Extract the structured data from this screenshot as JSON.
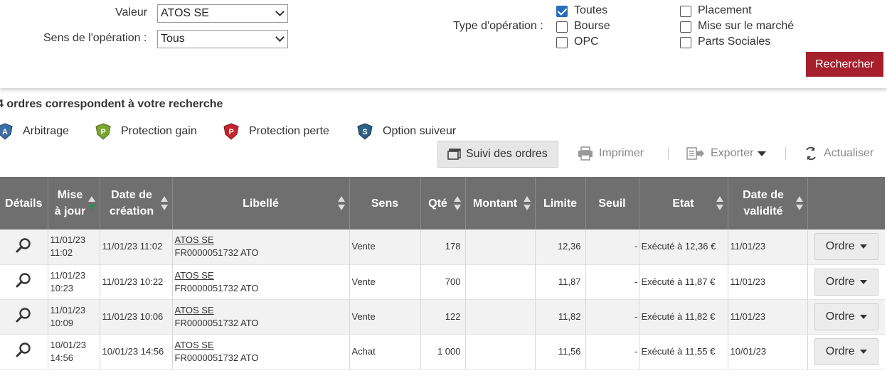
{
  "filters": {
    "valeur_label": "Valeur",
    "valeur_value": "ATOS SE",
    "sens_label": "Sens de l'opération :",
    "sens_value": "Tous",
    "type_label": "Type d'opération :",
    "types": [
      {
        "label": "Toutes",
        "checked": true
      },
      {
        "label": "Bourse",
        "checked": false
      },
      {
        "label": "OPC",
        "checked": false
      },
      {
        "label": "Placement",
        "checked": false
      },
      {
        "label": "Mise sur le marché",
        "checked": false
      },
      {
        "label": "Parts Sociales",
        "checked": false
      }
    ],
    "search_button": "Rechercher"
  },
  "results": {
    "count_text": "4 ordres correspondent à votre recherche",
    "legend": [
      {
        "letter": "A",
        "label": "Arbitrage",
        "color": "#3a6ea5"
      },
      {
        "letter": "P",
        "label": "Protection gain",
        "color": "#7aa531"
      },
      {
        "letter": "P",
        "label": "Protection perte",
        "color": "#c8242e"
      },
      {
        "letter": "S",
        "label": "Option suiveur",
        "color": "#2f5f83"
      }
    ],
    "toolbar": {
      "suivi": "Suivi des ordres",
      "imprimer": "Imprimer",
      "exporter": "Exporter",
      "actualiser": "Actualiser"
    }
  },
  "table": {
    "headers": [
      "Détails",
      "Mise à jour",
      "Date de création",
      "Libellé",
      "Sens",
      "Qté",
      "Montant",
      "Limite",
      "Seuil",
      "Etat",
      "Date de validité",
      ""
    ],
    "rows": [
      {
        "maj_date": "11/01/23",
        "maj_time": "11:02",
        "creation": "11/01/23 11:02",
        "lib_name": "ATOS SE",
        "lib_code": "FR0000051732 ATO",
        "sens": "Vente",
        "qte": "178",
        "montant": "",
        "limite": "12,36",
        "seuil": "-",
        "etat": "Exécuté à 12,36 €",
        "validite": "11/01/23",
        "action": "Ordre"
      },
      {
        "maj_date": "11/01/23",
        "maj_time": "10:23",
        "creation": "11/01/23 10:22",
        "lib_name": "ATOS SE",
        "lib_code": "FR0000051732 ATO",
        "sens": "Vente",
        "qte": "700",
        "montant": "",
        "limite": "11,87",
        "seuil": "-",
        "etat": "Exécuté à 11,87 €",
        "validite": "11/01/23",
        "action": "Ordre"
      },
      {
        "maj_date": "11/01/23",
        "maj_time": "10:09",
        "creation": "11/01/23 10:06",
        "lib_name": "ATOS SE",
        "lib_code": "FR0000051732 ATO",
        "sens": "Vente",
        "qte": "122",
        "montant": "",
        "limite": "11,82",
        "seuil": "-",
        "etat": "Exécuté à 11,82 €",
        "validite": "11/01/23",
        "action": "Ordre"
      },
      {
        "maj_date": "10/01/23",
        "maj_time": "14:56",
        "creation": "10/01/23 14:56",
        "lib_name": "ATOS SE",
        "lib_code": "FR0000051732 ATO",
        "sens": "Achat",
        "qte": "1 000",
        "montant": "",
        "limite": "11,56",
        "seuil": "-",
        "etat": "Exécuté à 11,55 €",
        "validite": "10/01/23",
        "action": "Ordre"
      }
    ]
  },
  "icons": {
    "details": "magnifier-icon",
    "print": "printer-icon",
    "export": "export-icon",
    "refresh": "refresh-icon",
    "suivi": "window-icon"
  },
  "colors": {
    "accent": "#a51f2d",
    "header_bg": "#6f6f6f",
    "checkbox": "#2a6ebb"
  }
}
